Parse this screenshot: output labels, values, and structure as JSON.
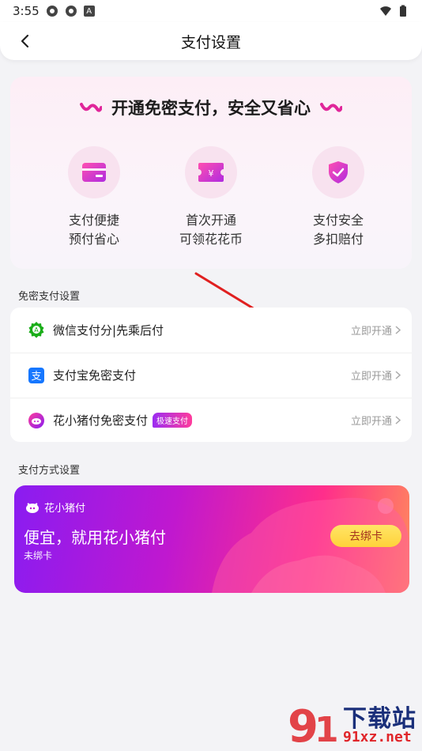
{
  "status_bar": {
    "time": "3:55",
    "carrier_badge": "A"
  },
  "header": {
    "title": "支付设置"
  },
  "promo": {
    "title": "开通免密支付，安全又省心",
    "features": [
      {
        "icon": "card-icon",
        "line1": "支付便捷",
        "line2": "预付省心"
      },
      {
        "icon": "coupon-yen-icon",
        "line1": "首次开通",
        "line2": "可领花花币"
      },
      {
        "icon": "shield-check-icon",
        "line1": "支付安全",
        "line2": "多扣赔付"
      }
    ]
  },
  "password_free_section": {
    "label": "免密支付设置",
    "items": [
      {
        "icon": "wechat-pay-score-icon",
        "label": "微信支付分|先乘后付",
        "action": "立即开通"
      },
      {
        "icon": "alipay-icon",
        "label": "支付宝免密支付",
        "action": "立即开通"
      },
      {
        "icon": "huaxiaozhu-pay-icon",
        "label": "花小猪付免密支付",
        "badge": "极速支付",
        "action": "立即开通"
      }
    ]
  },
  "payment_method_section": {
    "label": "支付方式设置",
    "card": {
      "brand": "花小猪付",
      "headline": "便宜，就用花小猪付",
      "status": "未绑卡",
      "button": "去绑卡"
    }
  },
  "watermark": {
    "text_cn": "下载站",
    "text_url": "91xz.net"
  },
  "colors": {
    "accent_pink": "#ff2e8b",
    "accent_purple": "#8a1cf1",
    "button_yellow": "#ffd23a",
    "wechat_green": "#1aad19",
    "alipay_blue": "#1677ff"
  }
}
